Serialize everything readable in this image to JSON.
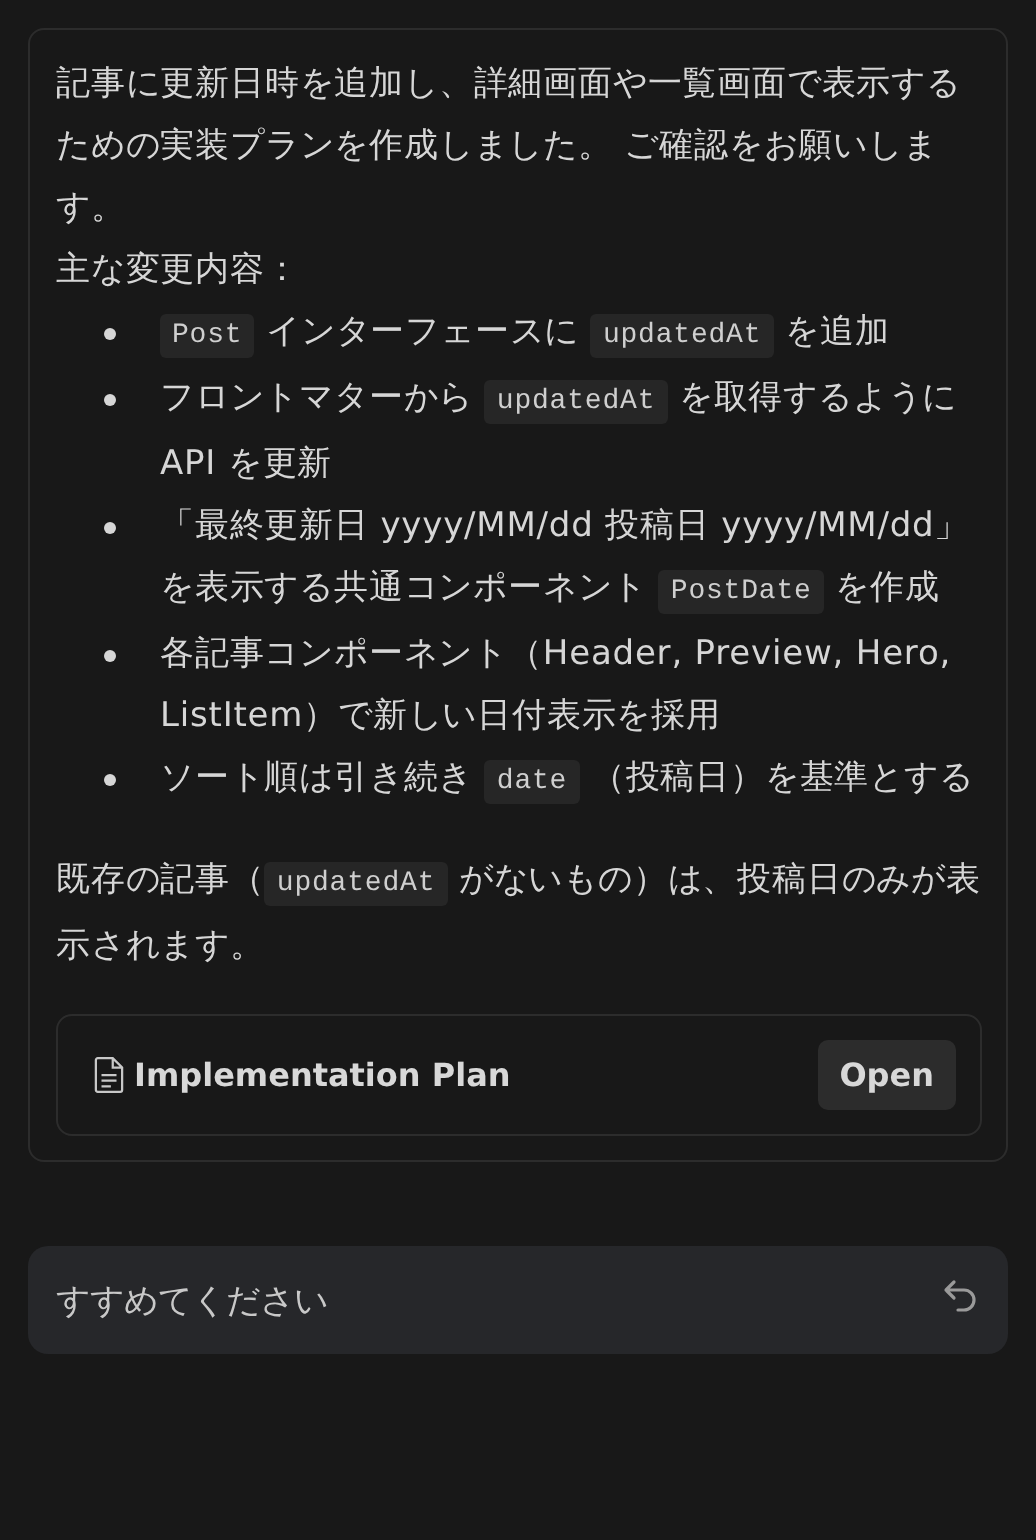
{
  "message": {
    "intro": [
      {
        "kind": "text",
        "text": "記事に更新日時を追加し、詳細画面や一覧画面で表示するための実装プランを作成しました。 ご確認をお願いします。"
      }
    ],
    "heading": [
      {
        "kind": "text",
        "text": "主な変更内容："
      }
    ],
    "bullets": [
      [
        {
          "kind": "code",
          "text": "Post"
        },
        {
          "kind": "text",
          "text": " インターフェースに "
        },
        {
          "kind": "code",
          "text": "updatedAt"
        },
        {
          "kind": "text",
          "text": " を追加"
        }
      ],
      [
        {
          "kind": "text",
          "text": "フロントマターから "
        },
        {
          "kind": "code",
          "text": "updatedAt"
        },
        {
          "kind": "text",
          "text": " を取得するように API を更新"
        }
      ],
      [
        {
          "kind": "text",
          "text": "「最終更新日 yyyy/MM/dd 投稿日 yyyy/MM/dd」を表示する共通コンポーネント "
        },
        {
          "kind": "code",
          "text": "PostDate"
        },
        {
          "kind": "text",
          "text": " を作成"
        }
      ],
      [
        {
          "kind": "text",
          "text": "各記事コンポーネント（Header, Preview, Hero, ListItem）で新しい日付表示を採用"
        }
      ],
      [
        {
          "kind": "text",
          "text": "ソート順は引き続き "
        },
        {
          "kind": "code",
          "text": "date"
        },
        {
          "kind": "text",
          "text": " （投稿日）を基準とする"
        }
      ]
    ],
    "note": [
      {
        "kind": "text",
        "text": "既存の記事（"
      },
      {
        "kind": "code",
        "text": "updatedAt"
      },
      {
        "kind": "text",
        "text": " がないもの）は、投稿日のみが表示されます。"
      }
    ]
  },
  "artifact": {
    "title": "Implementation Plan",
    "button": "Open"
  },
  "reply_field": {
    "value": "すすめてください"
  }
}
